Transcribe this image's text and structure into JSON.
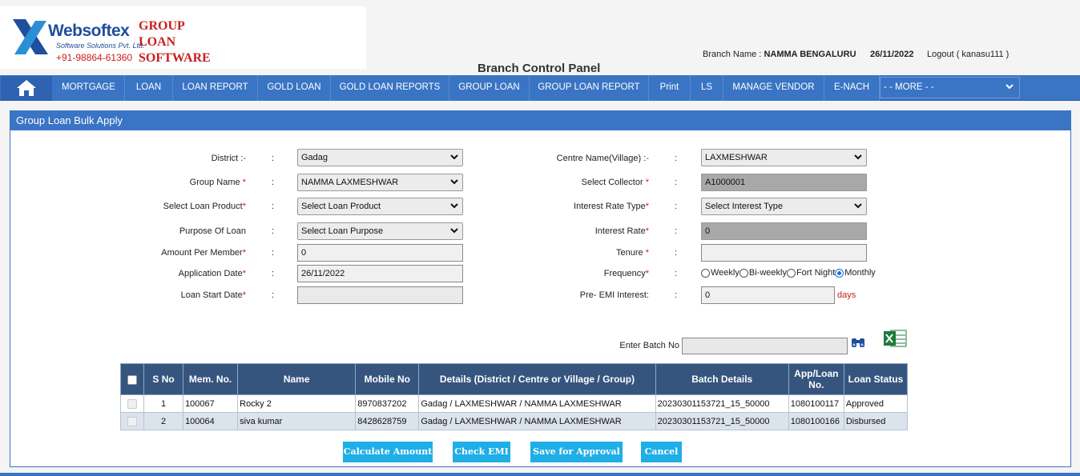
{
  "logo": {
    "name": "Websoftex",
    "subtitle": "Software Solutions Pvt. Ltd.",
    "phone": "+91-98864-61360",
    "product_line1": "GROUP",
    "product_line2": "LOAN",
    "product_line3": "SOFTWARE"
  },
  "header": {
    "branch_label": "Branch Name :",
    "branch_name": "NAMMA BENGALURU",
    "date": "26/11/2022",
    "logout": "Logout ( kanasu111 )",
    "panel_title": "Branch Control Panel"
  },
  "nav": {
    "items": [
      "MORTGAGE",
      "LOAN",
      "LOAN REPORT",
      "GOLD LOAN",
      "GOLD LOAN REPORTS",
      "GROUP LOAN",
      "GROUP LOAN REPORT",
      "Print",
      "LS",
      "MANAGE VENDOR",
      "E-NACH"
    ],
    "more": "- - MORE - -"
  },
  "form": {
    "title": "Group Loan Bulk Apply",
    "left": {
      "district": {
        "label": "District :",
        "req": "-",
        "value": "Gadag"
      },
      "group_name": {
        "label": "Group Name",
        "req": "*",
        "value": "NAMMA LAXMESHWAR"
      },
      "loan_product": {
        "label": "Select Loan Product",
        "req": "*",
        "value": "Select Loan Product"
      },
      "purpose": {
        "label": "Purpose Of Loan",
        "req": "",
        "value": "Select Loan Purpose"
      },
      "amount": {
        "label": "Amount Per Member",
        "req": "*",
        "value": "0"
      },
      "app_date": {
        "label": "Application Date",
        "req": "*",
        "value": "26/11/2022"
      },
      "start_date": {
        "label": "Loan Start Date",
        "req": "*",
        "value": ""
      }
    },
    "right": {
      "centre": {
        "label": "Centre Name(Village) :",
        "req": "-",
        "value": "LAXMESHWAR"
      },
      "collector": {
        "label": "Select Collector",
        "req": "*",
        "value": "A1000001"
      },
      "rate_type": {
        "label": "Interest Rate Type",
        "req": "*",
        "value": "Select Interest Type"
      },
      "rate": {
        "label": "Interest Rate",
        "req": "*",
        "value": "0"
      },
      "tenure": {
        "label": "Tenure",
        "req": "*",
        "value": ""
      },
      "frequency": {
        "label": "Frequency",
        "req": "*",
        "options": [
          "Weekly",
          "Bi-weekly",
          "Fort Night",
          "Monthly"
        ],
        "selected": "Monthly"
      },
      "pre_emi": {
        "label": "Pre- EMI Interest:",
        "value": "0",
        "unit": "days"
      }
    },
    "colon": ":",
    "batch": {
      "label": "Enter Batch No",
      "value": ""
    }
  },
  "table": {
    "headers": [
      "S No",
      "Mem. No.",
      "Name",
      "Mobile No",
      "Details (District / Centre or Village / Group)",
      "Batch Details",
      "App/Loan No.",
      "Loan Status"
    ],
    "rows": [
      {
        "sno": "1",
        "mem": "100067",
        "name": "Rocky 2",
        "mobile": "8970837202",
        "details": "Gadag / LAXMESHWAR / NAMMA LAXMESHWAR",
        "batch": "20230301153721_15_50000",
        "app": "1080100117",
        "status": "Approved"
      },
      {
        "sno": "2",
        "mem": "100064",
        "name": "siva kumar",
        "mobile": "8428628759",
        "details": "Gadag / LAXMESHWAR / NAMMA LAXMESHWAR",
        "batch": "20230301153721_15_50000",
        "app": "1080100166",
        "status": "Disbursed"
      }
    ]
  },
  "buttons": {
    "calculate": "Calculate Amount",
    "check_emi": "Check EMI",
    "save": "Save for Approval",
    "cancel": "Cancel"
  },
  "colors": {
    "nav": "#3a74c4",
    "table_header": "#36557e",
    "button": "#1faee6",
    "brand_red": "#c81e1e",
    "brand_blue": "#1f4e9c"
  },
  "icons": {
    "home": "home-icon",
    "search": "binoculars-icon",
    "excel": "excel-icon",
    "dropdown": "chevron-down-icon"
  }
}
